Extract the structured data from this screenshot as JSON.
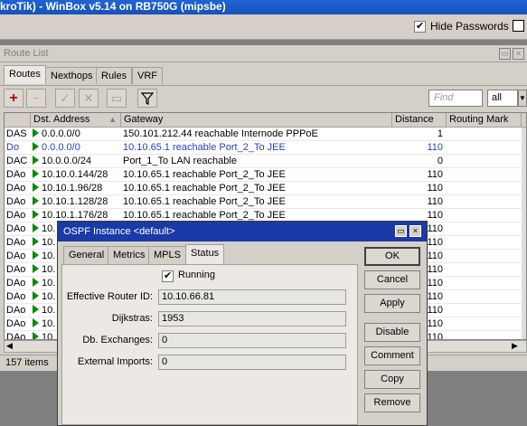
{
  "window": {
    "title": "kroTik) - WinBox v5.14 on RB750G (mipsbe)",
    "hide_passwords_label": "Hide Passwords",
    "hide_passwords_checked": true
  },
  "route_list": {
    "title": "Route List",
    "tabs": [
      "Routes",
      "Nexthops",
      "Rules",
      "VRF"
    ],
    "active_tab": "Routes",
    "find_placeholder": "Find",
    "filter_value": "all",
    "columns": [
      "",
      "Dst. Address",
      "Gateway",
      "Distance",
      "Routing Mark"
    ],
    "rows": [
      {
        "flags": "DAS",
        "dst": "0.0.0.0/0",
        "gateway": "150.101.212.44 reachable Internode PPPoE",
        "distance": "1",
        "style": "normal"
      },
      {
        "flags": "Do",
        "dst": "0.0.0.0/0",
        "gateway": "10.10.65.1 reachable Port_2_To JEE",
        "distance": "110",
        "style": "blue"
      },
      {
        "flags": "DAC",
        "dst": "10.0.0.0/24",
        "gateway": "Port_1_To LAN reachable",
        "distance": "0",
        "style": "normal"
      },
      {
        "flags": "DAo",
        "dst": "10.10.0.144/28",
        "gateway": "10.10.65.1 reachable Port_2_To JEE",
        "distance": "110",
        "style": "normal"
      },
      {
        "flags": "DAo",
        "dst": "10.10.1.96/28",
        "gateway": "10.10.65.1 reachable Port_2_To JEE",
        "distance": "110",
        "style": "normal"
      },
      {
        "flags": "DAo",
        "dst": "10.10.1.128/28",
        "gateway": "10.10.65.1 reachable Port_2_To JEE",
        "distance": "110",
        "style": "normal"
      },
      {
        "flags": "DAo",
        "dst": "10.10.1.176/28",
        "gateway": "10.10.65.1 reachable Port_2_To JEE",
        "distance": "110",
        "style": "normal"
      },
      {
        "flags": "DAo",
        "dst": "10.",
        "gateway": "",
        "distance": "110",
        "style": "normal"
      },
      {
        "flags": "DAo",
        "dst": "10.",
        "gateway": "",
        "distance": "110",
        "style": "normal"
      },
      {
        "flags": "DAo",
        "dst": "10.",
        "gateway": "",
        "distance": "110",
        "style": "normal"
      },
      {
        "flags": "DAo",
        "dst": "10.",
        "gateway": "",
        "distance": "110",
        "style": "normal"
      },
      {
        "flags": "DAo",
        "dst": "10.",
        "gateway": "",
        "distance": "110",
        "style": "normal"
      },
      {
        "flags": "DAo",
        "dst": "10.",
        "gateway": "",
        "distance": "110",
        "style": "normal"
      },
      {
        "flags": "DAo",
        "dst": "10.",
        "gateway": "",
        "distance": "110",
        "style": "normal"
      },
      {
        "flags": "DAo",
        "dst": "10.",
        "gateway": "",
        "distance": "110",
        "style": "normal"
      },
      {
        "flags": "DAo",
        "dst": "10.",
        "gateway": "",
        "distance": "110",
        "style": "normal"
      }
    ],
    "status": "157 items"
  },
  "dialog": {
    "title": "OSPF Instance <default>",
    "tabs": [
      "General",
      "Metrics",
      "MPLS",
      "Status"
    ],
    "active_tab": "Status",
    "running_label": "Running",
    "running_checked": true,
    "fields": [
      {
        "label": "Effective Router ID:",
        "value": "10.10.66.81"
      },
      {
        "label": "Dijkstras:",
        "value": "1953"
      },
      {
        "label": "Db. Exchanges:",
        "value": "0"
      },
      {
        "label": "External Imports:",
        "value": "0"
      }
    ],
    "buttons": [
      "OK",
      "Cancel",
      "Apply",
      "Disable",
      "Comment",
      "Copy",
      "Remove"
    ]
  }
}
